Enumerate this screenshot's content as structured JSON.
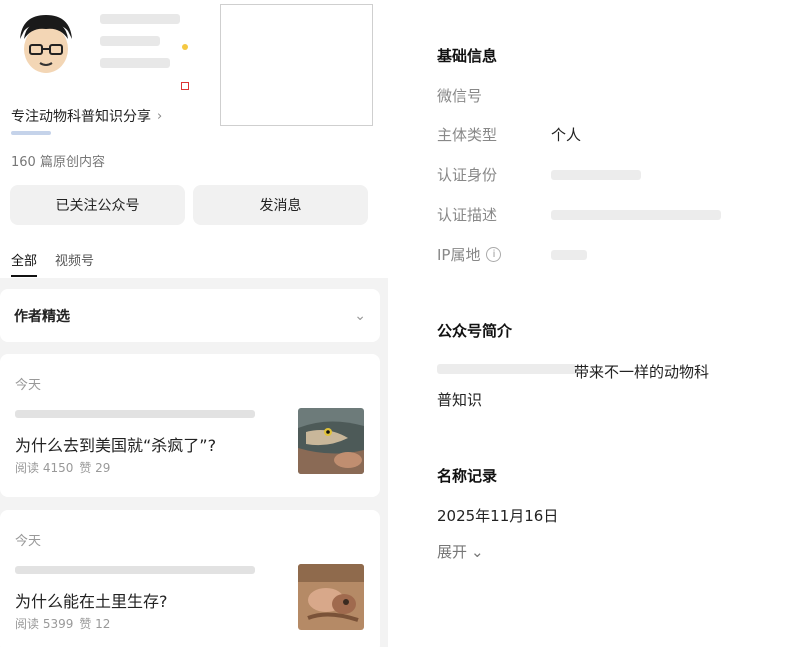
{
  "profile": {
    "description": "专注动物科普知识分享",
    "original_count": "160 篇原创内容"
  },
  "actions": {
    "follow_label": "已关注公众号",
    "message_label": "发消息"
  },
  "tabs": [
    {
      "label": "全部",
      "active": true
    },
    {
      "label": "视频号",
      "active": false
    }
  ],
  "picks": {
    "title": "作者精选"
  },
  "articles": [
    {
      "day": "今天",
      "title": "为什么去到美国就“杀疯了”?",
      "reads": "阅读 4150",
      "likes": "赞 29",
      "thumb_icon": "fish-photo"
    },
    {
      "day": "今天",
      "title": "为什么能在土里生存?",
      "reads": "阅读 5399",
      "likes": "赞 12",
      "thumb_icon": "animal-photo"
    }
  ],
  "basic_info": {
    "title": "基础信息",
    "rows": [
      {
        "label": "微信号",
        "value": ""
      },
      {
        "label": "主体类型",
        "value": "个人"
      },
      {
        "label": "认证身份",
        "value": ""
      },
      {
        "label": "认证描述",
        "value": ""
      },
      {
        "label": "IP属地",
        "value": ""
      }
    ]
  },
  "intro": {
    "title": "公众号简介",
    "text_line1": "带来不一样的动物科",
    "text_line2": "普知识"
  },
  "name_history": {
    "title": "名称记录",
    "date": "2025年11月16日",
    "expand_label": "展开"
  },
  "colors": {
    "accent_red": "#dd3333",
    "follow_bg": "#f1f1f1"
  }
}
